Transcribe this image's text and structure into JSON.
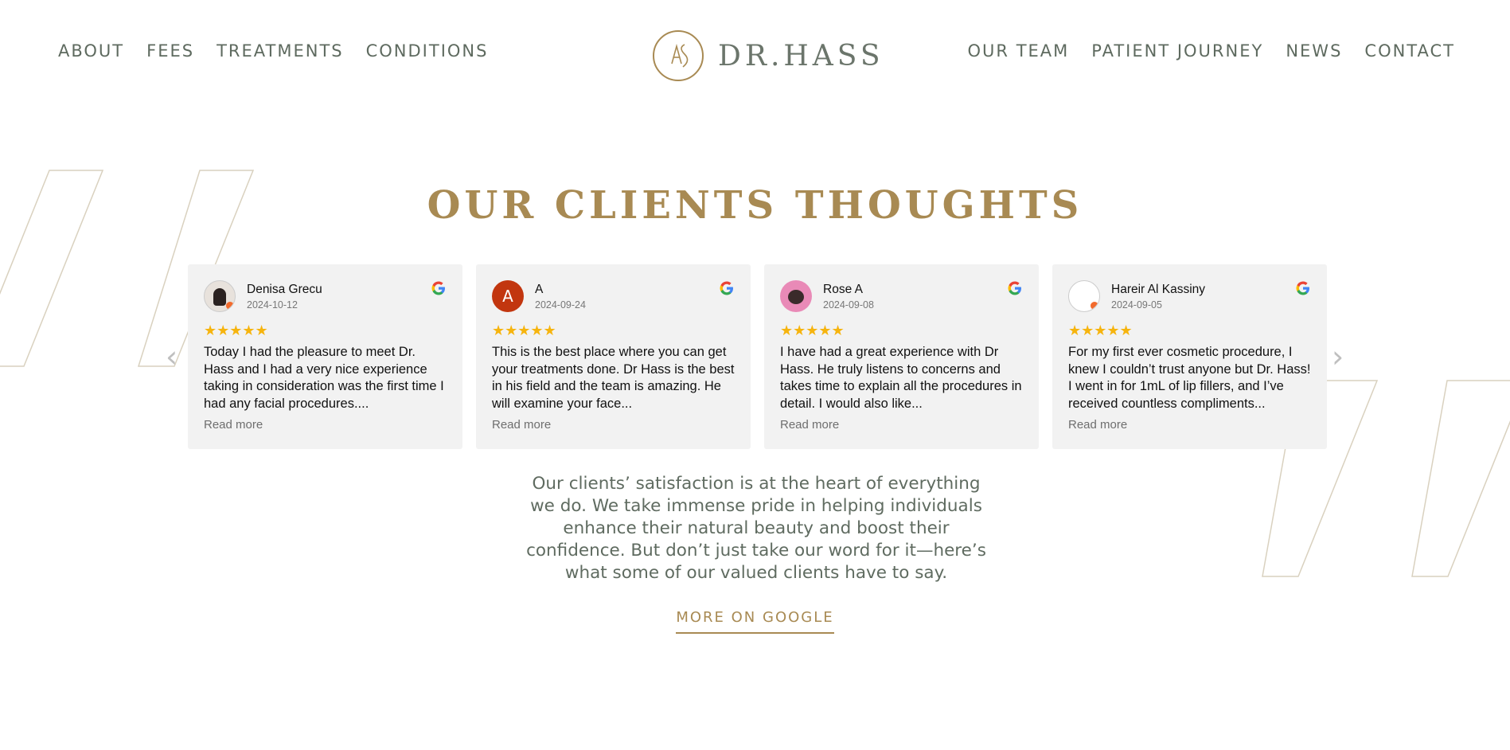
{
  "header": {
    "nav_left": [
      "ABOUT",
      "FEES",
      "TREATMENTS",
      "CONDITIONS"
    ],
    "nav_right": [
      "OUR TEAM",
      "PATIENT JOURNEY",
      "NEWS",
      "CONTACT"
    ],
    "logo_text": "DR.HASS"
  },
  "section": {
    "heading": "OUR CLIENTS THOUGHTS",
    "description": "Our clients’ satisfaction is at the heart of everything we do. We take immense pride in helping individuals enhance their natural beauty and boost their confidence. But don’t just take our word for it—here’s what some of our valued clients have to say.",
    "cta_label": "MORE ON GOOGLE"
  },
  "reviews": [
    {
      "name": "Denisa Grecu",
      "date": "2024-10-12",
      "stars": "★★★★★",
      "text": "Today I had the pleasure to meet Dr. Hass and I had a very nice experience taking in consideration was the first time I had any facial procedures....",
      "read_more": "Read more"
    },
    {
      "name": "A",
      "initial": "A",
      "date": "2024-09-24",
      "stars": "★★★★★",
      "text": "This is the best place where you can get your treatments done. Dr Hass is the best in his field and the team is amazing. He will examine your face...",
      "read_more": "Read more"
    },
    {
      "name": "Rose A",
      "date": "2024-09-08",
      "stars": "★★★★★",
      "text": "I have had a great experience with Dr Hass. He truly listens to concerns and takes time to explain all the procedures in detail. I would also like...",
      "read_more": "Read more"
    },
    {
      "name": "Hareir Al Kassiny",
      "date": "2024-09-05",
      "stars": "★★★★★",
      "text": "For my first ever cosmetic procedure, I knew I couldn’t trust anyone but Dr. Hass! I went in for 1mL of lip fillers, and I’ve received countless compliments...",
      "read_more": "Read more"
    }
  ],
  "carousel": {
    "prev_icon": "‹",
    "next_icon": "›"
  },
  "colors": {
    "gold": "#a88a53",
    "nav_text": "#5e6a5f",
    "card_bg": "#f2f2f2",
    "star": "#f6b40e"
  }
}
